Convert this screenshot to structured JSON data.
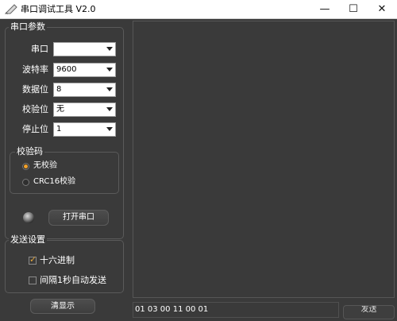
{
  "window": {
    "title": "串口调试工具 V2.0",
    "minimize": "—",
    "maximize": "☐",
    "close": "✕"
  },
  "params": {
    "group_title": "串口参数",
    "port": {
      "label": "串口",
      "value": ""
    },
    "baud": {
      "label": "波特率",
      "value": "9600"
    },
    "databits": {
      "label": "数据位",
      "value": "8"
    },
    "parity": {
      "label": "校验位",
      "value": "无"
    },
    "stopbits": {
      "label": "停止位",
      "value": "1"
    }
  },
  "checksum": {
    "group_title": "校验码",
    "options": [
      {
        "label": "无校验",
        "selected": true
      },
      {
        "label": "CRC16校验",
        "selected": false
      }
    ]
  },
  "open_port_label": "打开串口",
  "send_settings": {
    "group_title": "发送设置",
    "hex": {
      "label": "十六进制",
      "checked": true
    },
    "auto": {
      "label": "间隔1秒自动发送",
      "checked": false
    }
  },
  "clear_label": "清显示",
  "send_input_value": "01 03 00 11 00 01",
  "send_label": "发送",
  "colors": {
    "background": "#3a3a3a",
    "accent": "#f2a12a",
    "titlebar": "#ffffff"
  },
  "icons": {
    "app": "pen-icon",
    "minimize": "minimize-icon",
    "maximize": "maximize-icon",
    "close": "close-icon"
  }
}
